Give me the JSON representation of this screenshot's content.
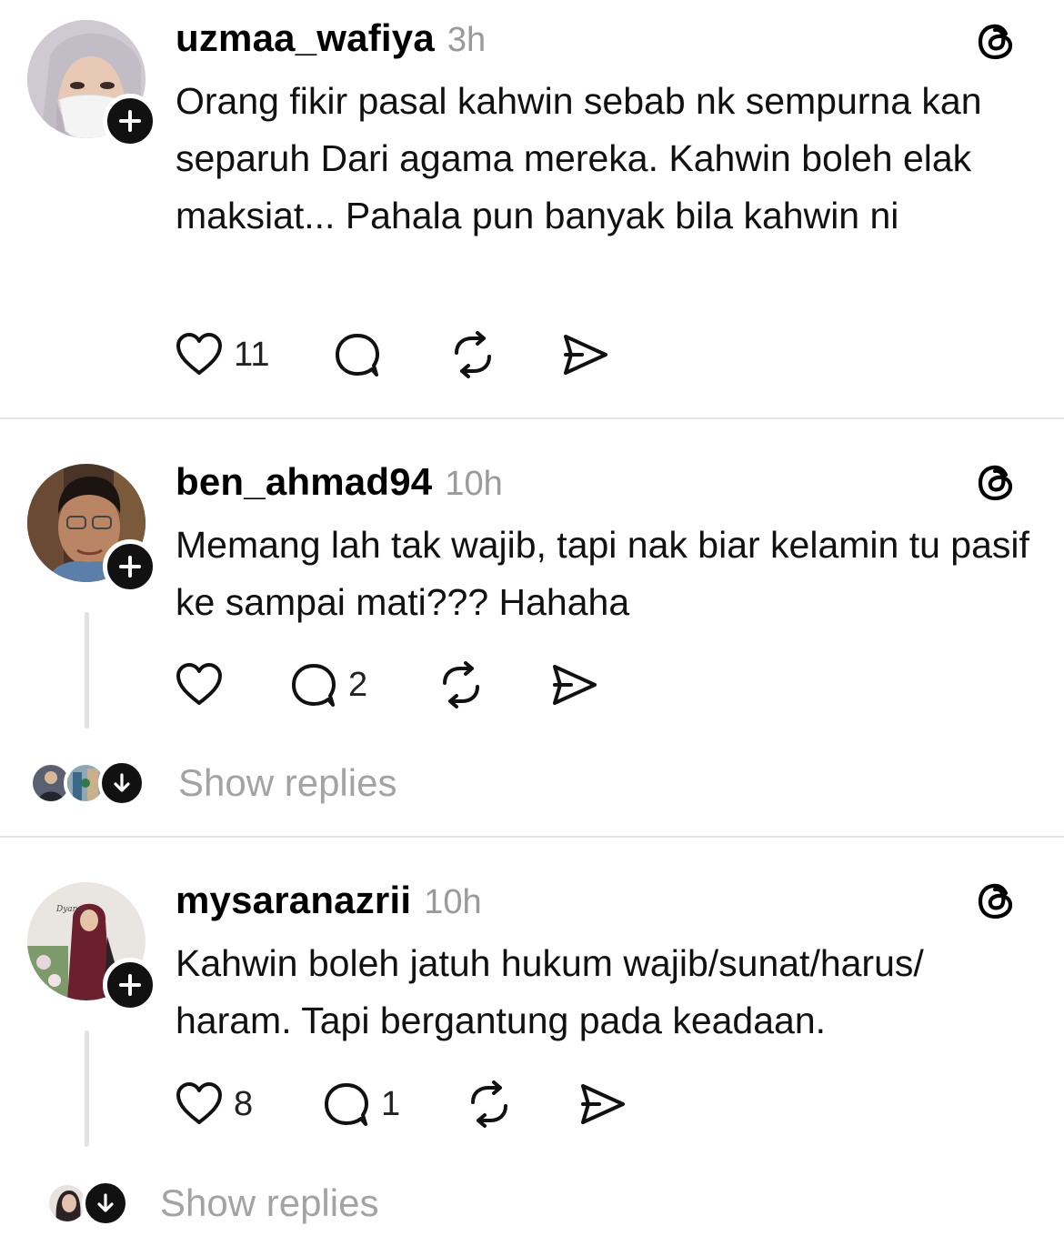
{
  "posts": [
    {
      "username": "uzmaa_wafiya",
      "time": "3h",
      "text": "Orang fikir pasal kahwin sebab nk sempurna kan separuh Dari agama mereka. Kahwin boleh elak maksiat... Pahala pun banyak bila kahwin ni",
      "likes": "11",
      "replies": ""
    },
    {
      "username": "ben_ahmad94",
      "time": "10h",
      "text": "Memang lah tak wajib, tapi nak biar kelamin tu pasif ke sampai mati??? Hahaha",
      "likes": "",
      "replies": "2",
      "show_replies": "Show replies"
    },
    {
      "username": "mysaranazrii",
      "time": "10h",
      "text": "Kahwin boleh jatuh hukum wajib/sunat/harus/ haram. Tapi bergantung pada keadaan.",
      "likes": "8",
      "replies": "1",
      "show_replies": "Show replies"
    }
  ],
  "icons": {
    "like": "heart-icon",
    "reply": "speech-bubble-icon",
    "repost": "repost-icon",
    "share": "send-icon",
    "app": "threads-logo-icon",
    "follow": "plus-icon",
    "expand": "arrow-down-icon"
  },
  "colors": {
    "text": "#111111",
    "muted": "#9a9a9a",
    "divider": "#e3e3e3",
    "badge": "#111111"
  }
}
